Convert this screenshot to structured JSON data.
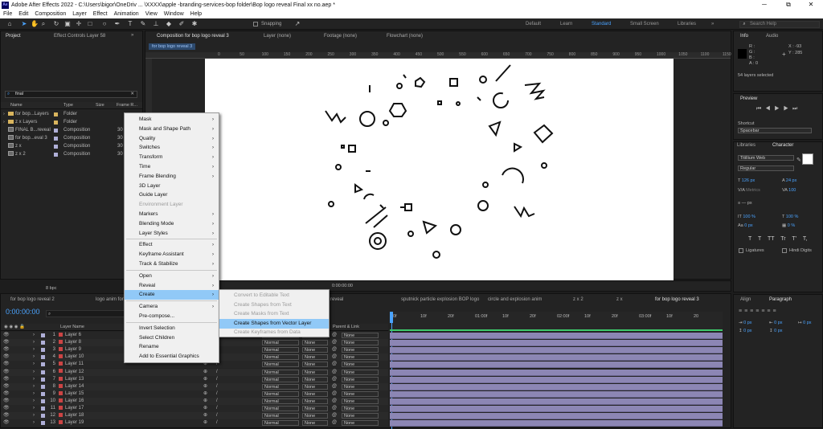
{
  "window": {
    "title": "Adobe After Effects 2022 - C:\\Users\\bigor\\OneDriv ... \\XXXX\\apple -branding-services-bop folder\\Bop logo reveal Final xx no.aep *",
    "app_icon": "Ae",
    "minimize": "─",
    "restore": "⧉",
    "close": "✕"
  },
  "menubar": [
    "File",
    "Edit",
    "Composition",
    "Layer",
    "Effect",
    "Animation",
    "View",
    "Window",
    "Help"
  ],
  "toolbar": {
    "snapping": "Snapping",
    "workspaces": [
      "Default",
      "Learn",
      "Standard",
      "Small Screen",
      "Libraries"
    ],
    "active_workspace": "Standard",
    "search_placeholder": "Search Help"
  },
  "project_panel": {
    "tab": "Project",
    "tab2": "Effect Controls Layer 58",
    "search_value": "final",
    "columns": [
      "Name",
      "Type",
      "Size",
      "Frame R..."
    ],
    "items": [
      {
        "name": "for bop...Layers",
        "type": "Folder",
        "size": "",
        "kind": "folder"
      },
      {
        "name": "z x Layers",
        "type": "Folder",
        "size": "",
        "kind": "folder"
      },
      {
        "name": "FINAL B...reveal",
        "type": "Composition",
        "size": "30",
        "kind": "comp"
      },
      {
        "name": "for bop...eval 3",
        "type": "Composition",
        "size": "30",
        "kind": "comp"
      },
      {
        "name": "z x",
        "type": "Composition",
        "size": "30",
        "kind": "comp"
      },
      {
        "name": "z x 2",
        "type": "Composition",
        "size": "30",
        "kind": "comp"
      }
    ],
    "bpc": "8 bpc"
  },
  "viewer": {
    "tabs": [
      {
        "label": "Composition for bop logo reveal 3",
        "active": true
      },
      {
        "label": "Layer (none)",
        "active": false
      },
      {
        "label": "Footage (none)",
        "active": false
      },
      {
        "label": "Flowchart (none)",
        "active": false
      }
    ],
    "subtab": "for bop logo reveal 3",
    "ruler": [
      "0",
      "50",
      "100",
      "150",
      "200",
      "250",
      "300",
      "350",
      "400",
      "450",
      "500",
      "550",
      "600",
      "650",
      "700",
      "750",
      "800",
      "850",
      "900",
      "950",
      "1000",
      "1050",
      "1100",
      "1150"
    ],
    "timecode": "0:00:00:00"
  },
  "info_panel": {
    "tab": "Info",
    "tab2": "Audio",
    "rgba": [
      "R :",
      "G :",
      "B :",
      "A : 0"
    ],
    "x": "X : -93",
    "y": "Y : 285",
    "status": "54 layers selected"
  },
  "preview_panel": {
    "title": "Preview",
    "shortcut_label": "Shortcut",
    "shortcut_value": "Spacebar"
  },
  "character_panel": {
    "tab": "Libraries",
    "tab2": "Character",
    "font": "Titillium Web",
    "style": "Regular",
    "size": "126 px",
    "leading": "24 px",
    "kerning": "Metrics",
    "tracking": "100",
    "stroke": "— px",
    "vscale": "100 %",
    "hscale": "100 %",
    "baseline": "0 px",
    "tsume": "0 %",
    "styles": [
      "T",
      "T",
      "TT",
      "Tr",
      "T'",
      "T,"
    ],
    "ligatures": "Ligatures",
    "hindi": "Hindi Digits"
  },
  "align_panel": {
    "tab": "Align",
    "tab2": "Paragraph",
    "indent": [
      "0 px",
      "0 px",
      "0 px",
      "0 px",
      "0 px"
    ]
  },
  "context_menu": {
    "items": [
      {
        "label": "Mask",
        "sub": true
      },
      {
        "label": "Mask and Shape Path",
        "sub": true
      },
      {
        "label": "Quality",
        "sub": true
      },
      {
        "label": "Switches",
        "sub": true
      },
      {
        "label": "Transform",
        "sub": true
      },
      {
        "label": "Time",
        "sub": true
      },
      {
        "label": "Frame Blending",
        "sub": true
      },
      {
        "label": "3D Layer"
      },
      {
        "label": "Guide Layer"
      },
      {
        "label": "Environment Layer",
        "disabled": true
      },
      {
        "label": "Markers",
        "sub": true
      },
      {
        "label": "Blending Mode",
        "sub": true
      },
      {
        "label": "Layer Styles",
        "sub": true
      },
      {
        "label": "Effect",
        "sub": true,
        "sepBefore": true
      },
      {
        "label": "Keyframe Assistant",
        "sub": true
      },
      {
        "label": "Track & Stabilize",
        "sub": true
      },
      {
        "label": "Open",
        "sub": true,
        "sepBefore": true
      },
      {
        "label": "Reveal",
        "sub": true
      },
      {
        "label": "Create",
        "sub": true,
        "highlight": true
      },
      {
        "label": "Camera",
        "sub": true,
        "sepBefore": true
      },
      {
        "label": "Pre-compose..."
      },
      {
        "label": "Invert Selection",
        "sepBefore": true
      },
      {
        "label": "Select Children"
      },
      {
        "label": "Rename"
      },
      {
        "label": "Add to Essential Graphics"
      }
    ],
    "submenu": [
      {
        "label": "Convert to Editable Text",
        "disabled": true
      },
      {
        "label": "Create Shapes from Text",
        "disabled": true
      },
      {
        "label": "Create Masks from Text",
        "disabled": true
      },
      {
        "label": "Create Shapes from Vector Layer",
        "highlight": true
      },
      {
        "label": "Create Keyframes from Data",
        "disabled": true
      }
    ]
  },
  "timeline": {
    "tabs": [
      "for bop logo reveal 2",
      "logo anim for",
      "reveal",
      "sputnick particle explosion BOP logo",
      "circle and explosion anim",
      "z x 2",
      "z x",
      "for bop logo reveal 3"
    ],
    "timecode": "0:00:00:00",
    "columns": [
      "Layer Name",
      "Parent & Link"
    ],
    "ticks": [
      "0f",
      "10f",
      "20f",
      "01:00f",
      "10f",
      "20f",
      "02:00f",
      "10f",
      "20f",
      "03:00f",
      "10f",
      "20"
    ],
    "mode_value": "Normal",
    "trkmat_value": "None",
    "parent_value": "None",
    "layers": [
      {
        "num": "1",
        "name": "Layer 6"
      },
      {
        "num": "2",
        "name": "Layer 8"
      },
      {
        "num": "3",
        "name": "Layer 9"
      },
      {
        "num": "4",
        "name": "Layer 10"
      },
      {
        "num": "5",
        "name": "Layer 11"
      },
      {
        "num": "6",
        "name": "Layer 12"
      },
      {
        "num": "7",
        "name": "Layer 13"
      },
      {
        "num": "8",
        "name": "Layer 14"
      },
      {
        "num": "9",
        "name": "Layer 15"
      },
      {
        "num": "10",
        "name": "Layer 16"
      },
      {
        "num": "11",
        "name": "Layer 17"
      },
      {
        "num": "12",
        "name": "Layer 18"
      },
      {
        "num": "13",
        "name": "Layer 19"
      }
    ]
  },
  "colors": {
    "accent": "#4aa3ff",
    "menu_highlight": "#91c9f7",
    "bar": "#8c86b4",
    "layer_label": "#c44444"
  }
}
